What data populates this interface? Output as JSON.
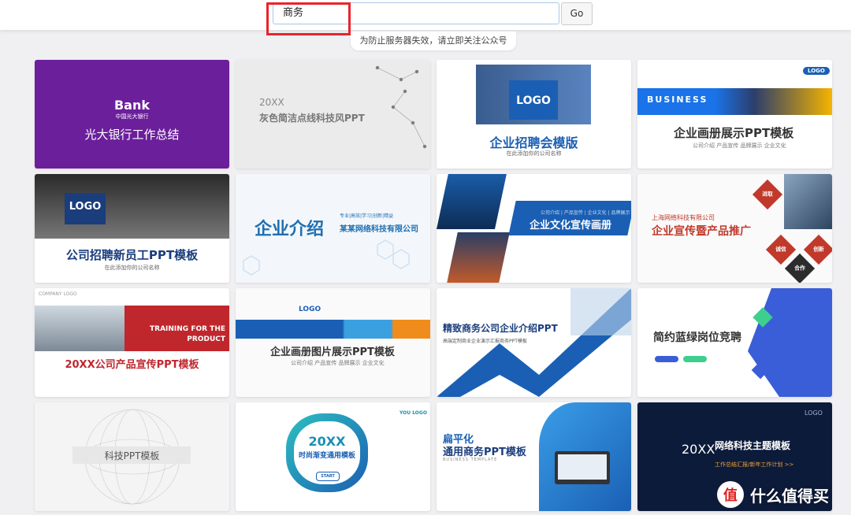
{
  "search": {
    "value": "商务",
    "go_label": "Go",
    "notice": "为防止服务器失效，请立即关注公众号"
  },
  "cards": [
    {
      "title": "光大银行工作总结",
      "sub": "Bank",
      "caption": "中国光大银行"
    },
    {
      "title": "灰色简洁点线科技风PPT",
      "sub": "20XX"
    },
    {
      "title": "企业招聘会模版",
      "sub": "LOGO",
      "caption": "在此添加你的公司名称"
    },
    {
      "title": "企业画册展示PPT模板",
      "sub": "BUSINESS",
      "caption": "公司介绍  产品宣传  品牌展示  企业文化",
      "badge": "LOGO"
    },
    {
      "title": "公司招聘新员工PPT模板",
      "sub": "LOGO",
      "caption": "在此添加你的公司名称"
    },
    {
      "title": "企业介绍",
      "sub": "某某网络科技有限公司",
      "caption": "专业|高效|学习|创新|精益"
    },
    {
      "title": "企业文化宣传画册",
      "caption": "公司介绍 | 产品宣传 | 企业文化 | 品牌展示"
    },
    {
      "title": "企业宣传暨产品推广",
      "sub": "上海网络科技有限公司",
      "tags": [
        "进取",
        "诚信",
        "创新",
        "合作"
      ]
    },
    {
      "title": "20XX公司产品宣传PPT模板",
      "sub": "TRAINING FOR THE PRODUCT",
      "caption": "COMPANY LOGO"
    },
    {
      "title": "企业画册图片展示PPT模板",
      "sub": "LOGO",
      "caption": "公司介绍  产品宣传  品牌展示  企业文化"
    },
    {
      "title": "精致商务公司企业介绍PPT",
      "caption": "高端定制商业企业演示汇报商务PPT模板"
    },
    {
      "title": "简约蓝绿岗位竞聘"
    },
    {
      "title": "科技PPT模板"
    },
    {
      "title": "20XX",
      "sub": "时尚渐变通用模板",
      "caption": "START",
      "badge": "YOU LOGO"
    },
    {
      "title": "通用商务PPT模板",
      "sub": "扁平化",
      "caption": "BUSINESS TEMPLATE"
    },
    {
      "title": "网络科技主题模板",
      "sub": "20XX",
      "caption": "工作总结汇报/新年工作计划 >>",
      "badge": "LOGO"
    }
  ],
  "watermark": {
    "icon": "值",
    "text": "什么值得买"
  }
}
